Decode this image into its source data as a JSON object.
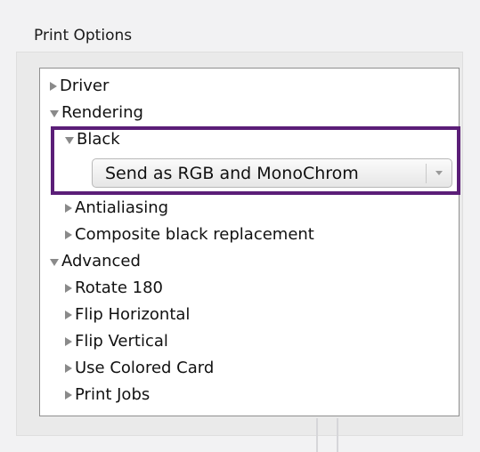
{
  "panel": {
    "title": "Print Options"
  },
  "tree": {
    "items": [
      {
        "label": "Driver",
        "state": "collapsed"
      },
      {
        "label": "Rendering",
        "state": "expanded"
      },
      {
        "label": "Black",
        "state": "expanded"
      },
      {
        "label": "Antialiasing",
        "state": "collapsed"
      },
      {
        "label": "Composite black replacement",
        "state": "collapsed"
      },
      {
        "label": "Advanced",
        "state": "expanded"
      },
      {
        "label": "Rotate 180",
        "state": "collapsed"
      },
      {
        "label": "Flip Horizontal",
        "state": "collapsed"
      },
      {
        "label": "Flip Vertical",
        "state": "collapsed"
      },
      {
        "label": "Use Colored Card",
        "state": "collapsed"
      },
      {
        "label": "Print Jobs",
        "state": "collapsed"
      }
    ]
  },
  "black_setting": {
    "selected": "Send as RGB and MonoChrom"
  },
  "colors": {
    "highlight": "#5b1e78",
    "arrow": "#8a8a8a"
  }
}
